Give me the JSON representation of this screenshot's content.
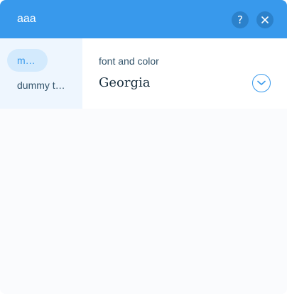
{
  "header": {
    "title": "aaa",
    "help_icon": "question-mark-icon",
    "close_icon": "close-x-icon",
    "help_glyph": "?",
    "bg_color": "#3899ec"
  },
  "sidebar": {
    "tabs": [
      {
        "label": "main",
        "selected": true
      },
      {
        "label": "dummy t…",
        "selected": false
      }
    ]
  },
  "content": {
    "field_label": "font and color",
    "font_dropdown": {
      "value": "Georgia",
      "icon": "chevron-down-icon"
    }
  },
  "colors": {
    "accent": "#3899ec",
    "text_dark": "#162d3d",
    "text_label": "#32536a",
    "sidebar_bg": "#eef6fe",
    "tab_selected_bg": "#d3eafd"
  }
}
